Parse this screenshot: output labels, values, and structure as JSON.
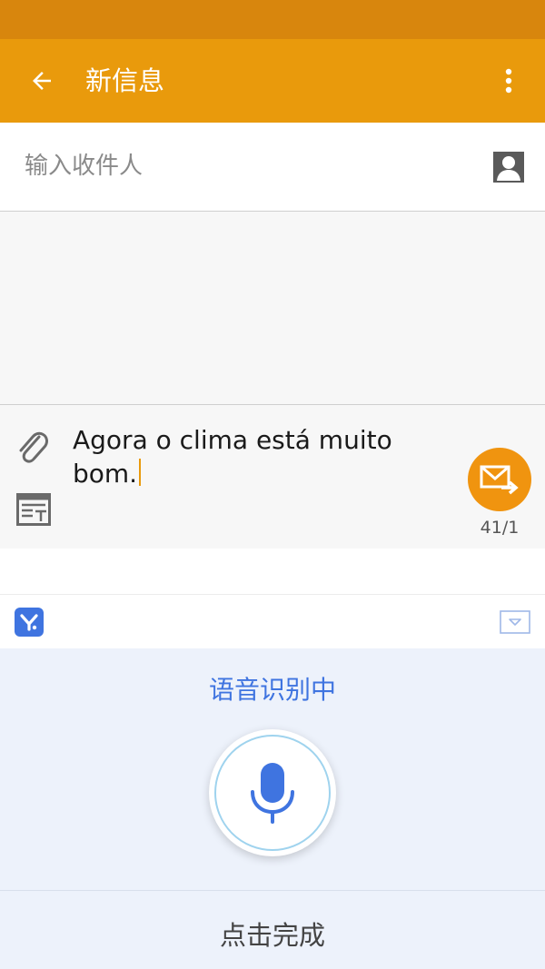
{
  "app_bar": {
    "title": "新信息",
    "back_icon": "arrow-left-icon",
    "more_icon": "more-vertical-icon"
  },
  "recipient": {
    "placeholder": "输入收件人",
    "value": "",
    "contact_icon": "contact-person-icon"
  },
  "compose": {
    "message_text": "Agora o clima está muito bom.",
    "attach_icon": "paperclip-icon",
    "template_icon": "text-template-icon",
    "send_icon": "send-message-icon",
    "counter": "41/1"
  },
  "ime": {
    "logo_icon": "ime-logo-icon",
    "collapse_icon": "collapse-keyboard-icon",
    "voice_status": "语音识别中",
    "mic_icon": "microphone-icon",
    "done_label": "点击完成"
  },
  "colors": {
    "status_bar": "#d8860d",
    "app_bar": "#e99a0c",
    "send_button": "#f0940f",
    "ime_accent": "#3f74e0",
    "voice_panel": "#edf2fb"
  }
}
